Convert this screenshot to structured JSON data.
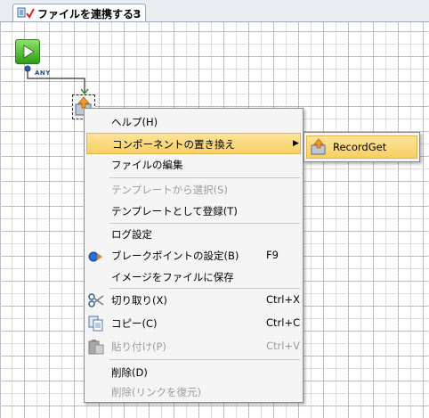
{
  "tab": {
    "title": "ファイルを連携する3",
    "close": "×"
  },
  "flow": {
    "connector_label": "ANY"
  },
  "context_menu": {
    "items": [
      {
        "label": "ヘルプ(H)"
      },
      {
        "label": "コンポーネントの置き換え",
        "submenu_arrow": "▶"
      },
      {
        "label": "ファイルの編集"
      },
      {
        "label": "テンプレートから選択(S)"
      },
      {
        "label": "テンプレートとして登録(T)"
      },
      {
        "label": "ログ設定"
      },
      {
        "label": "ブレークポイントの設定(B)",
        "shortcut": "F9"
      },
      {
        "label": "イメージをファイルに保存"
      },
      {
        "label": "切り取り(X)",
        "shortcut": "Ctrl+X"
      },
      {
        "label": "コピー(C)",
        "shortcut": "Ctrl+C"
      },
      {
        "label": "貼り付け(P)",
        "shortcut": "Ctrl+V"
      },
      {
        "label": "削除(D)"
      },
      {
        "label": "削除(リンクを復元)"
      }
    ]
  },
  "submenu": {
    "items": [
      {
        "label": "RecordGet"
      }
    ]
  },
  "colors": {
    "highlight": "#f8cf63",
    "play_green": "#2f9d17"
  }
}
